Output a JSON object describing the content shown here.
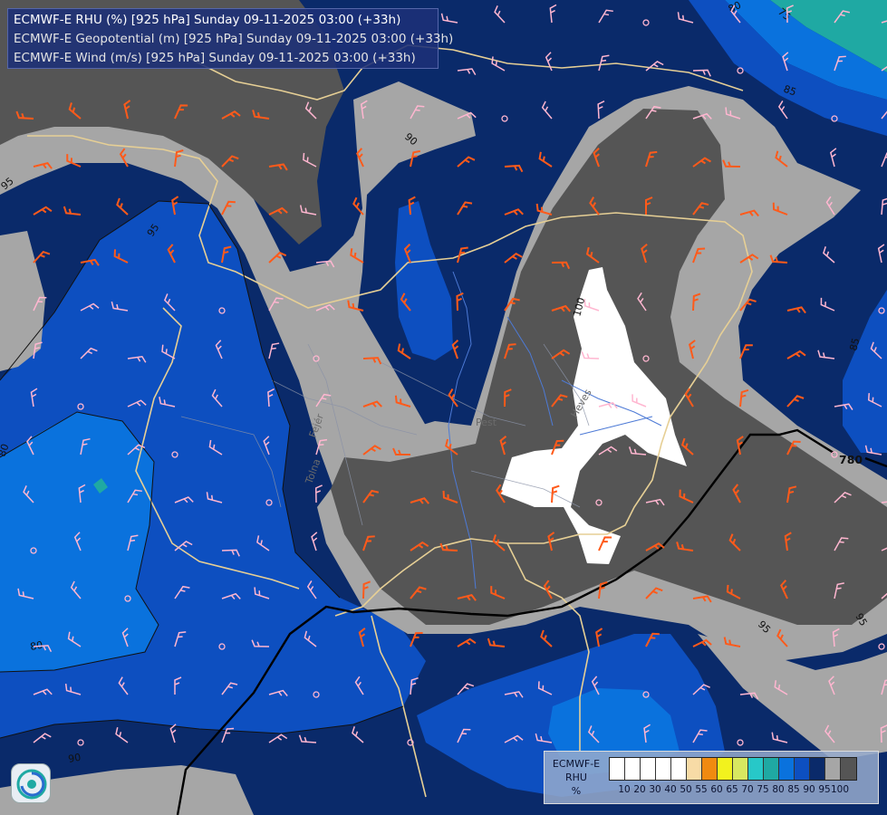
{
  "header": {
    "line1": "ECMWF-E RHU (%) [925 hPa] Sunday 09-11-2025 03:00 (+33h)",
    "line2": "ECMWF-E Geopotential (m) [925 hPa] Sunday 09-11-2025 03:00 (+33h)",
    "line3": "ECMWF-E Wind (m/s) [925 hPa] Sunday 09-11-2025 03:00 (+33h)"
  },
  "legend": {
    "title": [
      "ECMWF-E",
      "RHU",
      "%"
    ],
    "colors": [
      "#ffffff",
      "#ffffff",
      "#ffffff",
      "#ffffff",
      "#ffffff",
      "#f7dba6",
      "#f08a10",
      "#f2f21e",
      "#d8e860",
      "#27c8c8",
      "#1fa9a3",
      "#0a72dd",
      "#0d4fc0",
      "#0a2a6a",
      "#a6a6a6",
      "#555555"
    ],
    "ticks": [
      "10",
      "20",
      "30",
      "40",
      "50",
      "55",
      "60",
      "65",
      "70",
      "75",
      "80",
      "85",
      "90",
      "95",
      "100"
    ]
  },
  "contour_labels": {
    "geopotential": [
      "780"
    ],
    "rhu": [
      "80",
      "75",
      "85",
      "90",
      "95",
      "95",
      "85",
      "100",
      "80",
      "95",
      "90",
      "80",
      "90",
      "95"
    ]
  },
  "map_labels": [
    "Pest",
    "Fejér",
    "Tolna",
    "Heves"
  ],
  "logo": {
    "icon": "ecmwf-swirl-icon"
  }
}
